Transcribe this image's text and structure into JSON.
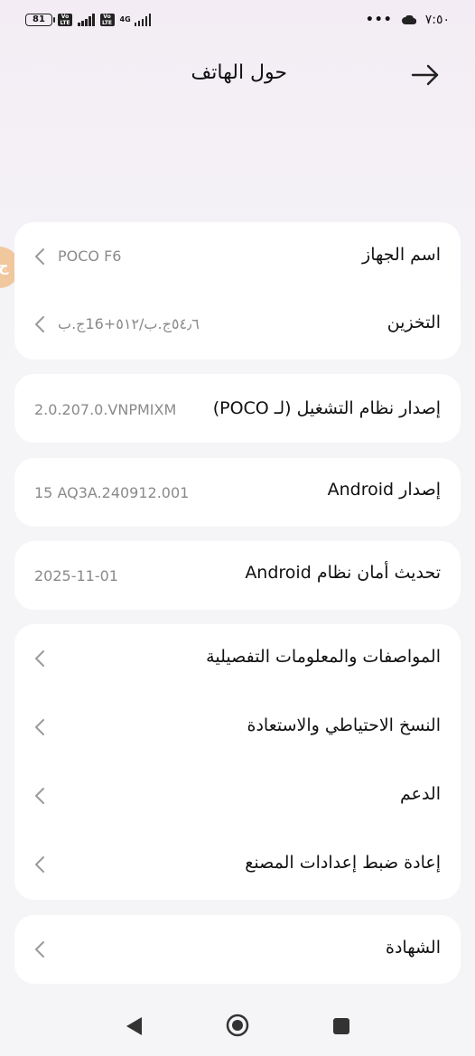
{
  "status_bar": {
    "battery": "81",
    "volte1": "Vo LTE",
    "volte2": "Vo LTE",
    "network": "4G",
    "time": "٧:٥٠",
    "dots": "•••"
  },
  "header": {
    "title": "حول الهاتف"
  },
  "side_tab_glyph": "ج",
  "device_card": {
    "name_label": "اسم الجهاز",
    "name_value": "POCO F6",
    "storage_label": "التخزين",
    "storage_value": "٥٤٫٦ج.ب/٥١٢+16ج.ب"
  },
  "os_card": {
    "label": "إصدار نظام التشغيل (لـ POCO)",
    "value": "2.0.207.0.VNPMIXM"
  },
  "android_card": {
    "label": "إصدار Android",
    "value": "15 AQ3A.240912.001"
  },
  "security_card": {
    "label": "تحديث أمان نظام Android",
    "value": "2025-11-01"
  },
  "menu_card": {
    "items": [
      {
        "label": "المواصفات والمعلومات التفصيلية"
      },
      {
        "label": "النسخ الاحتياطي والاستعادة"
      },
      {
        "label": "الدعم"
      },
      {
        "label": "إعادة ضبط إعدادات المصنع"
      }
    ]
  },
  "cert_card": {
    "label": "الشهادة"
  },
  "icons": {
    "back": "arrow-right-icon",
    "chevron": "chevron-left-icon",
    "nav_back": "triangle-back-icon",
    "nav_home": "circle-home-icon",
    "nav_recent": "square-recent-icon"
  }
}
